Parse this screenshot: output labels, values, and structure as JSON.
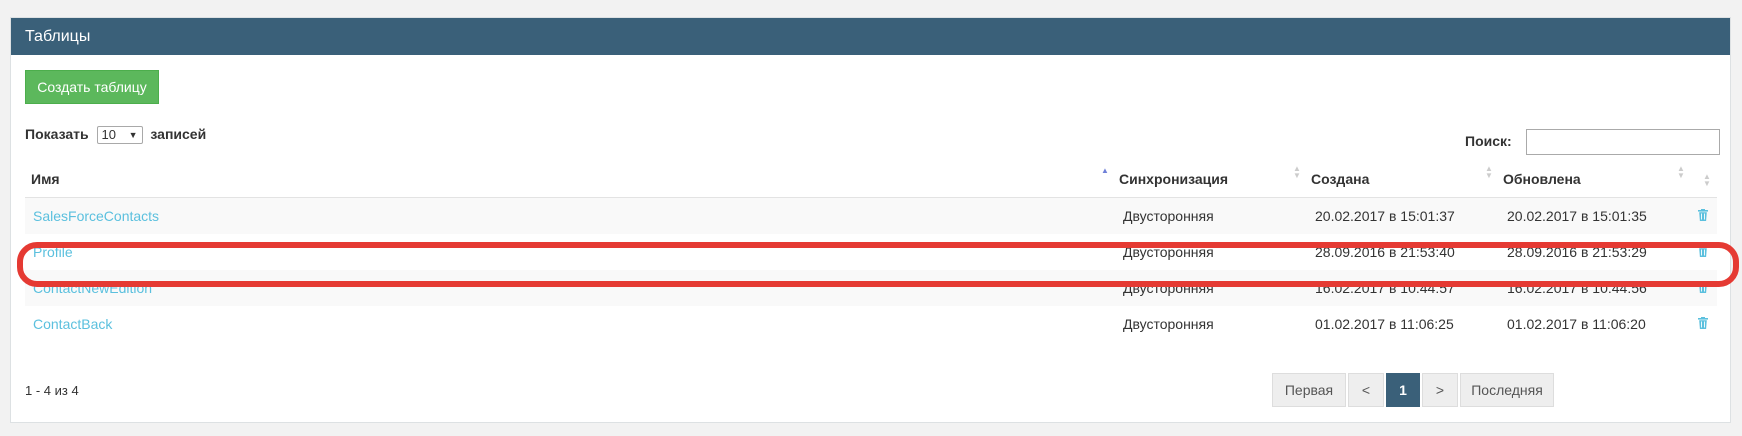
{
  "panel": {
    "title": "Таблицы"
  },
  "toolbar": {
    "create_label": "Создать таблицу"
  },
  "length": {
    "prefix": "Показать",
    "value": "10",
    "suffix": "записей"
  },
  "search": {
    "label": "Поиск:",
    "value": ""
  },
  "table": {
    "headers": {
      "name": "Имя",
      "sync": "Синхронизация",
      "created": "Создана",
      "updated": "Обновлена"
    },
    "rows": [
      {
        "name": "SalesForceContacts",
        "sync": "Двусторонняя",
        "created": "20.02.2017 в 15:01:37",
        "updated": "20.02.2017 в 15:01:35"
      },
      {
        "name": "Profile",
        "sync": "Двусторонняя",
        "created": "28.09.2016 в 21:53:40",
        "updated": "28.09.2016 в 21:53:29"
      },
      {
        "name": "ContactNewEdition",
        "sync": "Двусторонняя",
        "created": "16.02.2017 в 10:44:57",
        "updated": "16.02.2017 в 10:44:56"
      },
      {
        "name": "ContactBack",
        "sync": "Двусторонняя",
        "created": "01.02.2017 в 11:06:25",
        "updated": "01.02.2017 в 11:06:20"
      }
    ],
    "highlighted_row": "Profile"
  },
  "footer": {
    "info": "1 - 4 из 4",
    "pager": {
      "first": "Первая",
      "prev": "<",
      "current": "1",
      "next": ">",
      "last": "Последняя"
    }
  },
  "colors": {
    "header": "#3a6079",
    "create_button": "#5cb85c",
    "link": "#5bc0de",
    "highlight": "#e53a33"
  },
  "icons": {
    "delete": "trash-icon",
    "sort": "sort-arrows-icon"
  }
}
